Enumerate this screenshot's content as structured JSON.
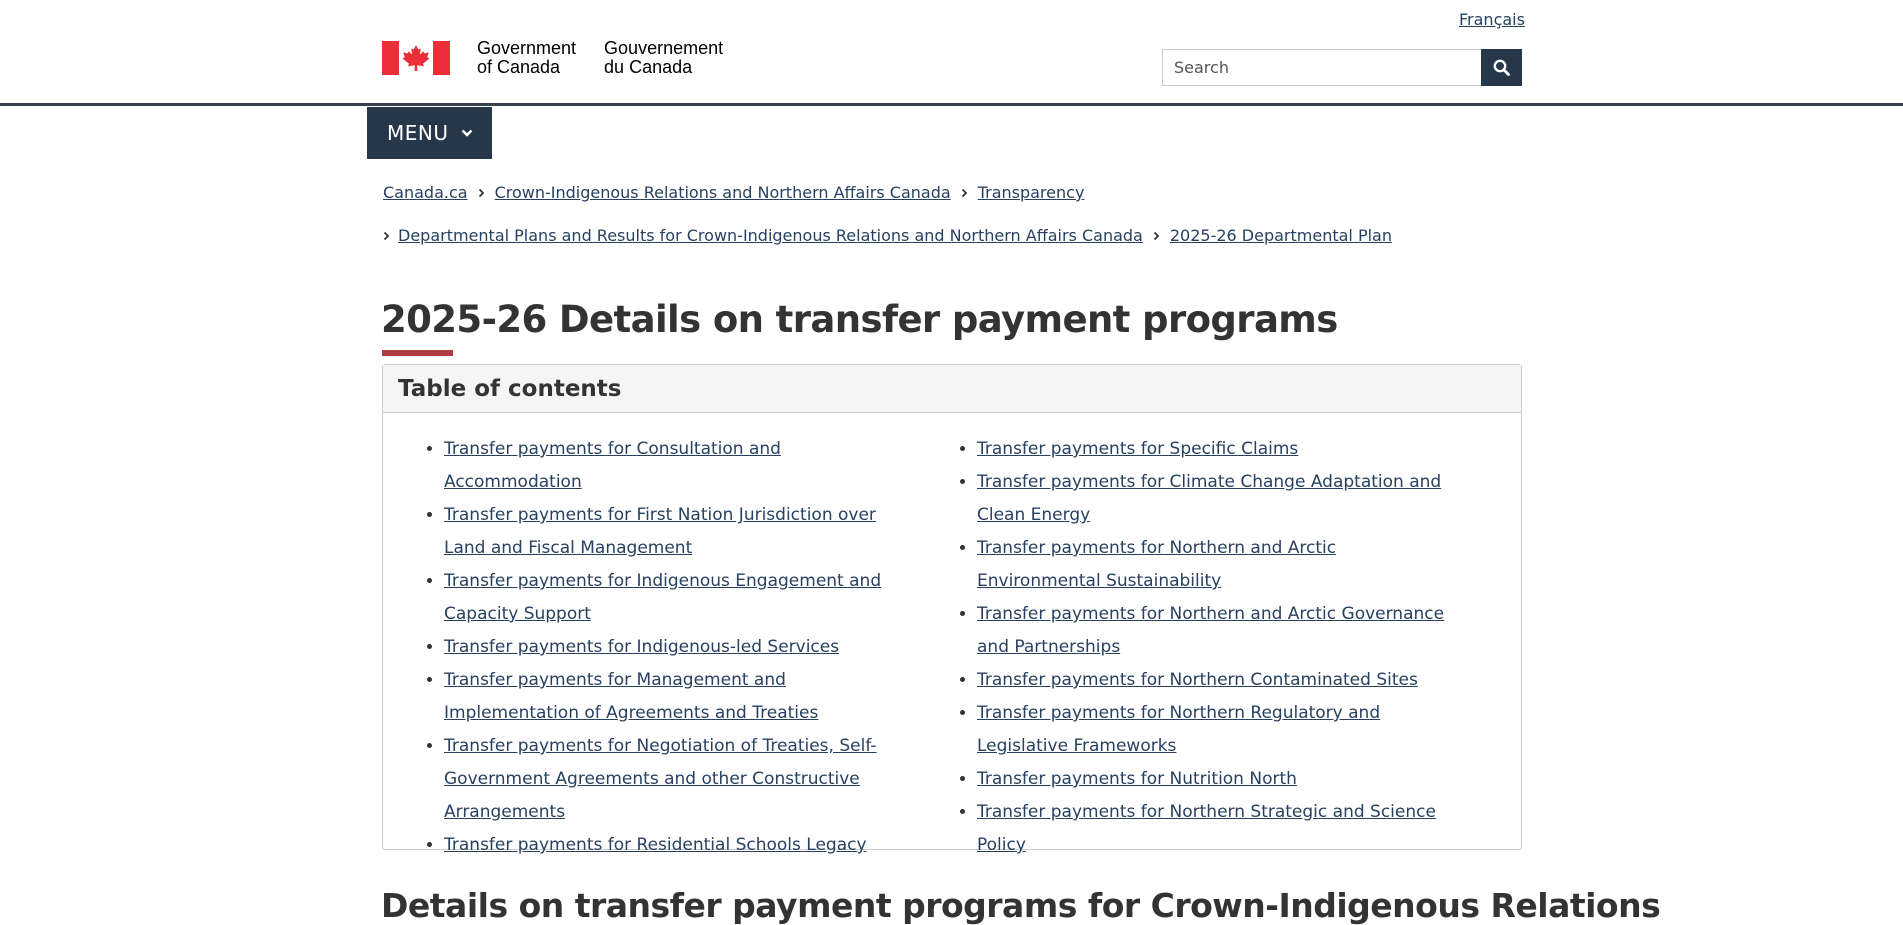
{
  "header": {
    "language_link": "Français",
    "gov_name_en_line1": "Government",
    "gov_name_en_line2": "of Canada",
    "gov_name_fr_line1": "Gouvernement",
    "gov_name_fr_line2": "du Canada",
    "search_placeholder": "Search",
    "flag_color": "#eb2d37",
    "search_button_color": "#26374a"
  },
  "menu": {
    "label": "MENU"
  },
  "breadcrumb": [
    "Canada.ca",
    "Crown-Indigenous Relations and Northern Affairs Canada",
    "Transparency",
    "Departmental Plans and Results for Crown-Indigenous Relations and Northern Affairs Canada",
    "2025-26 Departmental Plan"
  ],
  "page": {
    "title": "2025-26 Details on transfer payment programs",
    "accent_color": "#af3c43",
    "next_heading": "Details on transfer payment programs for Crown-Indigenous Relations"
  },
  "toc": {
    "heading": "Table of contents",
    "left": [
      "Transfer payments for Consultation and Accommodation",
      "Transfer payments for First Nation Jurisdiction over Land and Fiscal Management",
      "Transfer payments for Indigenous Engagement and Capacity Support",
      "Transfer payments for Indigenous-led Services",
      "Transfer payments for Management and Implementation of Agreements and Treaties",
      "Transfer payments for Negotiation of Treaties, Self-Government Agreements and other Constructive Arrangements",
      "Transfer payments for Residential Schools Legacy"
    ],
    "right": [
      "Transfer payments for Specific Claims",
      "Transfer payments for Climate Change Adaptation and Clean Energy",
      "Transfer payments for Northern and Arctic Environmental Sustainability",
      "Transfer payments for Northern and Arctic Governance and Partnerships",
      "Transfer payments for Northern Contaminated Sites",
      "Transfer payments for Northern Regulatory and Legislative Frameworks",
      "Transfer payments for Nutrition North",
      "Transfer payments for Northern Strategic and Science Policy"
    ]
  }
}
